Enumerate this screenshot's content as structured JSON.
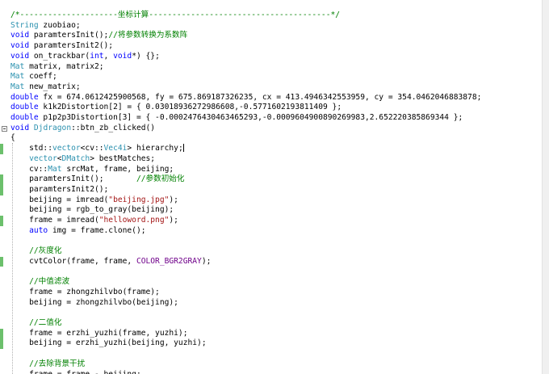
{
  "editor": {
    "lines": [
      [
        {
          "t": "/*---------------------坐标计算---------------------------------------*/",
          "c": "cm"
        }
      ],
      [
        {
          "t": "String",
          "c": "ty"
        },
        {
          "t": " zuobiao;"
        }
      ],
      [
        {
          "t": "void",
          "c": "kw"
        },
        {
          "t": " paramtersInit();"
        },
        {
          "t": "//将参数转换为系数阵",
          "c": "cm"
        }
      ],
      [
        {
          "t": "void",
          "c": "kw"
        },
        {
          "t": " paramtersInit2();"
        }
      ],
      [
        {
          "t": "void",
          "c": "kw"
        },
        {
          "t": " on_trackbar("
        },
        {
          "t": "int",
          "c": "kw"
        },
        {
          "t": ", "
        },
        {
          "t": "void",
          "c": "kw"
        },
        {
          "t": "*) {};"
        }
      ],
      [
        {
          "t": "Mat",
          "c": "ty"
        },
        {
          "t": " matrix, matrix2;"
        }
      ],
      [
        {
          "t": "Mat",
          "c": "ty"
        },
        {
          "t": " coeff;"
        }
      ],
      [
        {
          "t": "Mat",
          "c": "ty"
        },
        {
          "t": " new_matrix;"
        }
      ],
      [
        {
          "t": "double",
          "c": "kw"
        },
        {
          "t": " fx = 674.0612425900568, fy = 675.869187326235, cx = 413.4946342553959, cy = 354.0462046883878;"
        }
      ],
      [
        {
          "t": "double",
          "c": "kw"
        },
        {
          "t": " k1k2Distortion[2] = { 0.03018936272986608,-0.5771602193811409 };"
        }
      ],
      [
        {
          "t": "double",
          "c": "kw"
        },
        {
          "t": " p1p2p3Distortion[3] = { -0.0002476430463465293,-0.0009604900890269983,2.652220385869344 };"
        }
      ],
      [
        {
          "t": "void",
          "c": "kw"
        },
        {
          "t": " "
        },
        {
          "t": "Djdragon",
          "c": "ty"
        },
        {
          "t": "::btn_zb_clicked()"
        }
      ],
      [
        {
          "t": "{"
        }
      ],
      [
        {
          "t": "    std::"
        },
        {
          "t": "vector",
          "c": "ty"
        },
        {
          "t": "<cv::"
        },
        {
          "t": "Vec4i",
          "c": "ty"
        },
        {
          "t": "> hierarchy;"
        },
        {
          "t": "",
          "c": "caret"
        }
      ],
      [
        {
          "t": "    "
        },
        {
          "t": "vector",
          "c": "ty"
        },
        {
          "t": "<"
        },
        {
          "t": "DMatch",
          "c": "ty"
        },
        {
          "t": "> bestMatches;"
        }
      ],
      [
        {
          "t": "    cv::"
        },
        {
          "t": "Mat",
          "c": "ty"
        },
        {
          "t": " srcMat, frame, beijing;"
        }
      ],
      [
        {
          "t": "    paramtersInit();       "
        },
        {
          "t": "//参数初始化",
          "c": "cm"
        }
      ],
      [
        {
          "t": "    paramtersInit2();"
        }
      ],
      [
        {
          "t": "    beijing = imread("
        },
        {
          "t": "\"beijing.jpg\"",
          "c": "st"
        },
        {
          "t": ");"
        }
      ],
      [
        {
          "t": "    beijing = rgb_to_gray(beijing);"
        }
      ],
      [
        {
          "t": "    frame = imread("
        },
        {
          "t": "\"helloword.png\"",
          "c": "st"
        },
        {
          "t": ");"
        }
      ],
      [
        {
          "t": "    "
        },
        {
          "t": "auto",
          "c": "kw"
        },
        {
          "t": " img = frame.clone();"
        }
      ],
      [
        {
          "t": ""
        }
      ],
      [
        {
          "t": "    "
        },
        {
          "t": "//灰度化",
          "c": "cm"
        }
      ],
      [
        {
          "t": "    cvtColor(frame, frame, "
        },
        {
          "t": "COLOR_BGR2GRAY",
          "c": "mc"
        },
        {
          "t": ");"
        }
      ],
      [
        {
          "t": ""
        }
      ],
      [
        {
          "t": "    "
        },
        {
          "t": "//中值滤波",
          "c": "cm"
        }
      ],
      [
        {
          "t": "    frame = zhongzhilvbo(frame);"
        }
      ],
      [
        {
          "t": "    beijing = zhongzhilvbo(beijing);"
        }
      ],
      [
        {
          "t": ""
        }
      ],
      [
        {
          "t": "    "
        },
        {
          "t": "//二值化",
          "c": "cm"
        }
      ],
      [
        {
          "t": "    frame = erzhi_yuzhi(frame, yuzhi);"
        }
      ],
      [
        {
          "t": "    beijing = erzhi_yuzhi(beijing, yuzhi);"
        }
      ],
      [
        {
          "t": ""
        }
      ],
      [
        {
          "t": "    "
        },
        {
          "t": "//去除背景干扰",
          "c": "cm"
        }
      ],
      [
        {
          "t": "    frame = frame - beijing;"
        }
      ]
    ]
  }
}
